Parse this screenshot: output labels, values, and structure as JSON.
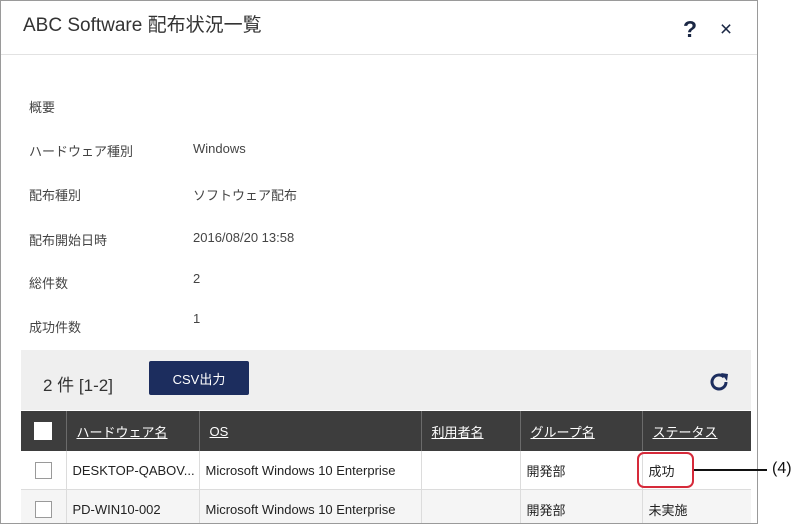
{
  "dialog": {
    "title": "ABC Software 配布状況一覧",
    "help_label": "?",
    "close_label": "×"
  },
  "summary": {
    "heading": "概要",
    "fields": [
      {
        "label": "ハードウェア種別",
        "value": "Windows"
      },
      {
        "label": "配布種別",
        "value": "ソフトウェア配布"
      },
      {
        "label": "配布開始日時",
        "value": "2016/08/20 13:58"
      },
      {
        "label": "総件数",
        "value": "2"
      },
      {
        "label": "成功件数",
        "value": "1"
      }
    ]
  },
  "toolbar": {
    "count": "2 件  [1-2]",
    "csv_label": "CSV出力",
    "refresh_icon": "refresh-icon"
  },
  "table": {
    "columns": [
      "ハードウェア名",
      "OS",
      "利用者名",
      "グループ名",
      "ステータス"
    ],
    "rows": [
      {
        "hardware": "DESKTOP-QABOV...",
        "os": "Microsoft Windows 10 Enterprise",
        "user": "",
        "group": "開発部",
        "status": "成功"
      },
      {
        "hardware": "PD-WIN10-002",
        "os": "Microsoft Windows 10 Enterprise",
        "user": "",
        "group": "開発部",
        "status": "未実施"
      }
    ]
  },
  "annotation": {
    "label": "(4)",
    "color": "#d62a3a"
  },
  "colors": {
    "accent": "#1c2d5e",
    "header_bg": "#3d3d3d"
  }
}
